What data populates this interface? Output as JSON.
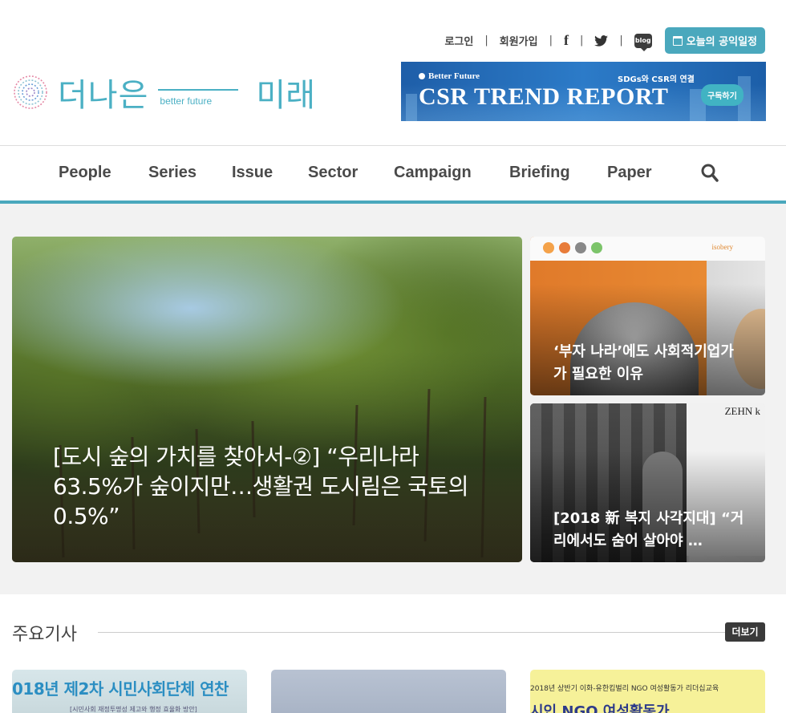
{
  "topbar": {
    "login": "로그인",
    "signup": "회원가입",
    "facebook": "f",
    "twitter": "🐦",
    "blog": "blog",
    "schedule": "오늘의 공익일정"
  },
  "logo": {
    "word1": "더나은",
    "sub": "better future",
    "word2": "미래"
  },
  "banner": {
    "brand": "Better Future",
    "tag": "SDGs와 CSR의 연결",
    "title": "CSR TREND REPORT",
    "subscribe": "구독하기"
  },
  "nav": {
    "items": [
      "People",
      "Series",
      "Issue",
      "Sector",
      "Campaign",
      "Briefing",
      "Paper"
    ]
  },
  "hero": {
    "main_title": "[도시 숲의 가치를 찾아서-②] “우리나라 63.5%가 숲이지만…생활권 도시림은 국토의 0.5%”",
    "side1_title": "‘부자 나라’에도 사회적기업가가 필요한 이유",
    "side1_brand": "isobery",
    "side2_title": "[2018 新 복지 사각지대] “거리에서도 숨어 살아야 …",
    "side2_sign": "ZEHN k"
  },
  "section": {
    "title": "주요기사",
    "more": "더보기"
  },
  "thumbs": {
    "t1_text": "018년 제2차 시민사회단체 연찬",
    "t1_sub": "[시민사회 재정투명성 제고와 행정 효율화 방안]",
    "t3_top": "2018년 상반기 이화-유한킴벌리 NGO 여성활동가 리더십교육",
    "t3_text": "시인 NGO 여성활동가"
  },
  "colors": {
    "accent": "#4aa8bd",
    "logo": "#4bb0c4",
    "banner": "#1e5ea8"
  }
}
